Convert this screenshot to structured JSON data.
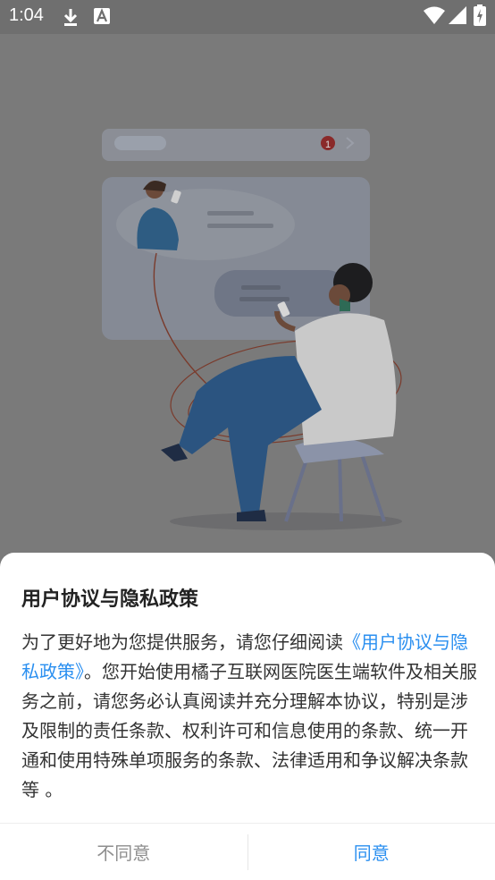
{
  "status_bar": {
    "time": "1:04",
    "icons": [
      "download-icon",
      "a-badge-icon",
      "wifi-icon",
      "signal-icon",
      "battery-icon"
    ]
  },
  "dialog": {
    "title": "用户协议与隐私政策",
    "body_prefix": "为了更好地为您提供服务，请您仔细阅读",
    "link_text": "《用户协议与隐私政策》",
    "body_suffix": "。您开始使用橘子互联网医院医生端软件及相关服务之前，请您务必认真阅读并充分理解本协议，特别是涉及限制的责任条款、权利许可和信息使用的条款、统一开通和使用特殊单项服务的条款、法律适用和争议解决条款等 。",
    "disagree_label": "不同意",
    "agree_label": "同意"
  },
  "colors": {
    "link": "#2a8ff0",
    "agree": "#2a8ff0",
    "disagree": "#8e8e8e",
    "overlay": "#7a7a7a"
  },
  "illustration": {
    "notification_count": "1"
  }
}
